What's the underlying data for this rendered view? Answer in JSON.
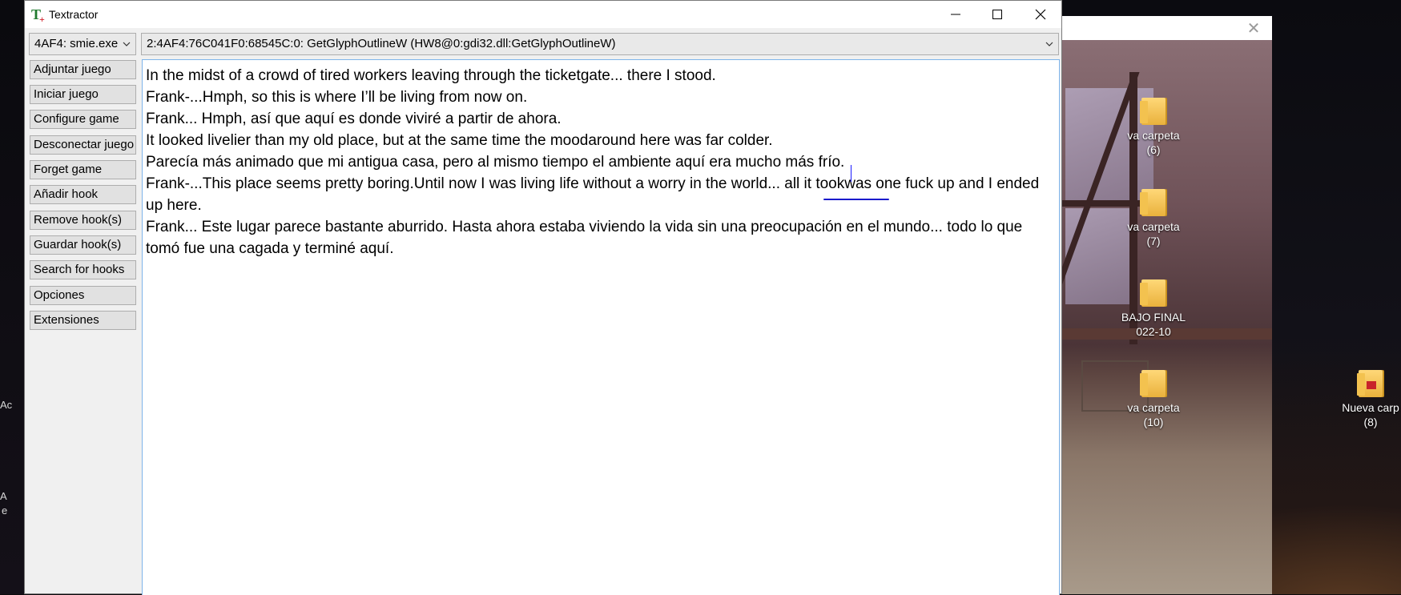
{
  "window": {
    "title": "Textractor"
  },
  "process_select": {
    "value": "4AF4: smie.exe"
  },
  "hook_select": {
    "value": "2:4AF4:76C041F0:68545C:0: GetGlyphOutlineW (HW8@0:gdi32.dll:GetGlyphOutlineW)"
  },
  "side_buttons": [
    {
      "label": "Adjuntar juego"
    },
    {
      "label": "Iniciar juego"
    },
    {
      "label": "Configure game"
    },
    {
      "label": "Desconectar juego"
    },
    {
      "label": "Forget game"
    },
    {
      "label": "Añadir hook"
    },
    {
      "label": "Remove hook(s)"
    },
    {
      "label": "Guardar hook(s)"
    },
    {
      "label": "Search for hooks"
    },
    {
      "label": "Opciones"
    },
    {
      "label": "Extensiones"
    }
  ],
  "output_lines": [
    "In the midst of a crowd of tired workers leaving through the ticketgate... there I stood.",
    "Frank-...Hmph, so this is where I’ll be living from now on.",
    "Frank... Hmph, así que aquí es donde viviré a partir de ahora.",
    "It looked livelier than my old place, but at the same time the moodaround here was far colder.",
    "Parecía más animado que mi antigua casa, pero al mismo tiempo el ambiente aquí era mucho más frío.",
    "Frank-...This place seems pretty boring.Until now I was living life without a worry in the world... all it tookwas one fuck up and I ended up here.",
    "Frank... Este lugar parece bastante aburrido. Hasta ahora estaba viviendo la vida sin una preocupación en el mundo... todo lo que tomó fue una cagada y terminé aquí."
  ],
  "desktop_icons": [
    {
      "label": "va carpeta\n(6)"
    },
    {
      "label": "va carpeta\n(7)"
    },
    {
      "label": "BAJO FINAL\n022-10"
    },
    {
      "label": "va carpeta\n(10)"
    },
    {
      "label": "Nueva carp\n(8)"
    }
  ],
  "edge_text": {
    "a1": "Ac",
    "a2": "A",
    "a3": "e"
  },
  "icons": {
    "app": "textractor-icon",
    "minimize": "minimize-icon",
    "maximize": "maximize-icon",
    "close": "close-icon",
    "dropdown": "chevron-down-icon",
    "folder": "folder-icon"
  },
  "colors": {
    "accent_border": "#7eb4ea",
    "button_face": "#e1e1e1",
    "folder": "#f3c24f"
  }
}
